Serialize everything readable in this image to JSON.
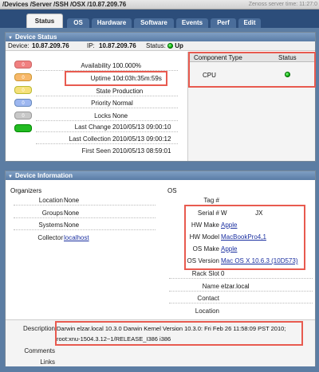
{
  "header": {
    "breadcrumb": "/Devices /Server /SSH /OSX /10.87.209.76",
    "server_time": "Zenoss server time: 11:27:0"
  },
  "tabs": [
    {
      "label": "Status",
      "active": true
    },
    {
      "label": "OS"
    },
    {
      "label": "Hardware"
    },
    {
      "label": "Software"
    },
    {
      "label": "Events"
    },
    {
      "label": "Perf"
    },
    {
      "label": "Edit"
    }
  ],
  "device_status": {
    "title": "Device Status",
    "device_label": "Device:",
    "device_value": "10.87.209.76",
    "ip_label": "IP:",
    "ip_value": "10.87.209.76",
    "status_label": "Status:",
    "status_value": "Up",
    "severity_counts": [
      "0",
      "0",
      "0",
      "0",
      "0",
      ""
    ],
    "fields": [
      {
        "label": "Availability",
        "value": "100.000%"
      },
      {
        "label": "Uptime",
        "value": "10d:03h:35m:59s"
      },
      {
        "label": "State",
        "value": "Production"
      },
      {
        "label": "Priority",
        "value": "Normal"
      },
      {
        "label": "Locks",
        "value": "None"
      },
      {
        "label": "Last Change",
        "value": "2010/05/13 09:00:10"
      },
      {
        "label": "Last Collection",
        "value": "2010/05/13 09:00:12"
      },
      {
        "label": "First Seen",
        "value": "2010/05/13 08:59:01"
      }
    ],
    "component_table": {
      "col_type": "Component Type",
      "col_status": "Status",
      "rows": [
        {
          "type": "CPU",
          "status": "green"
        }
      ]
    }
  },
  "device_info": {
    "title": "Device Information",
    "organizers_title": "Organizers",
    "organizers": [
      {
        "label": "Location",
        "value": "None"
      },
      {
        "label": "Groups",
        "value": "None"
      },
      {
        "label": "Systems",
        "value": "None"
      },
      {
        "label": "Collector",
        "value": "localhost",
        "link": true
      }
    ],
    "os_title": "OS",
    "os_fields": [
      {
        "label": "Tag #",
        "value": ""
      },
      {
        "label": "Serial #",
        "value": "W                JX"
      },
      {
        "label": "HW Make",
        "value": "Apple",
        "link": true
      },
      {
        "label": "HW Model",
        "value": "MacBookPro4,1",
        "link": true
      },
      {
        "label": "OS Make",
        "value": "Apple",
        "link": true
      },
      {
        "label": "OS Version",
        "value": "Mac OS X 10.6.3 (10D573)",
        "link": true
      },
      {
        "label": "Rack Slot",
        "value": "0"
      },
      {
        "label": "Name",
        "value": "elzar.local"
      },
      {
        "label": "Contact",
        "value": ""
      },
      {
        "label": "Location",
        "value": ""
      }
    ],
    "description_label": "Description",
    "description_line1": "Darwin elzar.local 10.3.0 Darwin Kernel Version 10.3.0: Fri Feb 26 11:58:09 PST 2010;",
    "description_line2": "root:xnu-1504.3.12~1/RELEASE_I386 i386",
    "comments_label": "Comments",
    "links_label": "Links"
  },
  "colors": {
    "sev_critical": "#f08080",
    "sev_error": "#f7b86a",
    "sev_warning": "#f5e07a",
    "sev_info": "#9db7f0",
    "sev_debug": "#c8c8c8",
    "sev_clear": "#22bb22",
    "highlight_box": "#e85a4f"
  }
}
